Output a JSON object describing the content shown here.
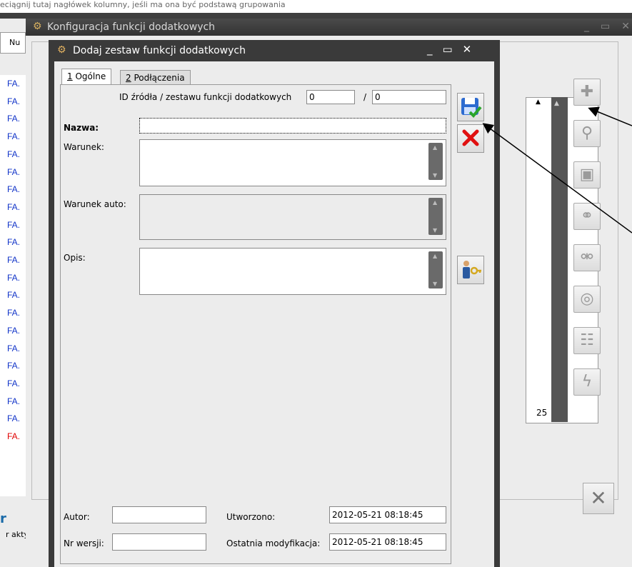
{
  "background_app": {
    "top_text": "eciągnij tutaj nagłówek kolumny, jeśli ma ona być podstawą grupowania",
    "tab_label": "Nu",
    "rows": [
      {
        "label": "FA.",
        "color": "#1033c8"
      },
      {
        "label": "FA.",
        "color": "#1033c8"
      },
      {
        "label": "FA.",
        "color": "#1033c8"
      },
      {
        "label": "FA.",
        "color": "#1033c8"
      },
      {
        "label": "FA.",
        "color": "#1033c8"
      },
      {
        "label": "FA.",
        "color": "#1033c8"
      },
      {
        "label": "FA.",
        "color": "#1033c8"
      },
      {
        "label": "FA.",
        "color": "#1033c8"
      },
      {
        "label": "FA.",
        "color": "#1033c8"
      },
      {
        "label": "FA.",
        "color": "#1033c8"
      },
      {
        "label": "FA.",
        "color": "#1033c8"
      },
      {
        "label": "FA.",
        "color": "#1033c8"
      },
      {
        "label": "FA.",
        "color": "#1033c8"
      },
      {
        "label": "FA.",
        "color": "#1033c8"
      },
      {
        "label": "FA.",
        "color": "#1033c8"
      },
      {
        "label": "FA.",
        "color": "#1033c8"
      },
      {
        "label": "FA.",
        "color": "#1033c8"
      },
      {
        "label": "FA.",
        "color": "#1033c8"
      },
      {
        "label": "FA.",
        "color": "#1033c8"
      },
      {
        "label": "FA.",
        "color": "#1033c8"
      },
      {
        "label": "FA.",
        "color": "#e00000"
      }
    ],
    "bottom_text": "r aktywn",
    "bottom_letter": "r"
  },
  "config_window": {
    "title": "Konfiguracja funkcji dodatkowych",
    "record_count": "25",
    "toolbar_icons": [
      "add-icon",
      "edit-icon",
      "delete-icon",
      "link-icon",
      "unlink-icon",
      "binoculars-icon",
      "list-icon",
      "lightning-icon"
    ],
    "toolbar_glyphs": [
      "✚",
      "⚲",
      "▣",
      "⚭",
      "⚮",
      "◎",
      "☷",
      "ϟ"
    ],
    "close_glyph": "✕"
  },
  "dialog": {
    "title": "Dodaj zestaw funkcji dodatkowych",
    "tabs": [
      {
        "key": "1",
        "label": "Ogólne"
      },
      {
        "key": "2",
        "label": "Podłączenia"
      }
    ],
    "id_label": "ID źródła / zestawu funkcji dodatkowych",
    "id_value1": "0",
    "id_separator": "/",
    "id_value2": "0",
    "nazwa_label": "Nazwa:",
    "nazwa_value": "",
    "warunek_label": "Warunek:",
    "warunek_auto_label": "Warunek auto:",
    "opis_label": "Opis:",
    "autor_label": "Autor:",
    "autor_value": "",
    "wersja_label": "Nr wersji:",
    "wersja_value": "",
    "utworzono_label": "Utworzono:",
    "utworzono_value": "2012-05-21 08:18:45",
    "modyfikacja_label": "Ostatnia modyfikacja:",
    "modyfikacja_value": "2012-05-21 08:18:45"
  }
}
